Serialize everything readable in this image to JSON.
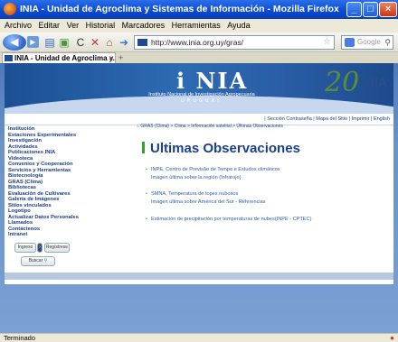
{
  "window": {
    "title": "INIA - Unidad de Agroclima y Sistemas de Información - Mozilla Firefox"
  },
  "menu": [
    "Archivo",
    "Editar",
    "Ver",
    "Historial",
    "Marcadores",
    "Herramientas",
    "Ayuda"
  ],
  "navbar": {
    "url": "http://www.inia.org.uy/gras/",
    "search_placeholder": "Google"
  },
  "tab": {
    "label": "INIA - Unidad de Agroclima y..."
  },
  "banner": {
    "logo": "i NIA",
    "org_name": "Instituto Nacional de Investigación Agropecuaria",
    "country": "URUGUAY",
    "anniversary": "20",
    "anniversary_logo": "i NIA"
  },
  "topnav": "| Sección Contraseña | Mapa del Sitio | Imprimir | English",
  "sidebar": {
    "items": [
      "Institución",
      "Estaciones Experimentales",
      "Investigación",
      "Actividades",
      "Publicaciones INIA",
      "Videoteca",
      "Convenios y Cooperación",
      "Servicios y Herramientas",
      "Biotecnología",
      "GRAS (Clima)",
      "Bibliotecas",
      "Evaluación de Cultivares",
      "Galería de Imágenes",
      "Sitios vinculados",
      "Logotipo",
      "Actualizar Datos Personales",
      "Llamados",
      "Contáctenos",
      "Intranet"
    ],
    "ingreso_label": "Ingreso",
    "registrarse_label": "Regístrese",
    "buscar_label": "Buscar"
  },
  "breadcrumb": {
    "home": "GRAS (Clima)",
    "trail": "> Clima > Información satelital > Últimas Observaciones"
  },
  "main": {
    "title": "Ultimas Observaciones",
    "items": [
      {
        "line1": "INPE, Centro de Previsão de Tempo e Estudos climáticos",
        "line2": "Imagen última sobre la región (Infrarojo)"
      },
      {
        "line1": "SMNA, Temperatura de topes nubosos",
        "line2": "Imagen última sobre América del Sur - Referencias"
      },
      {
        "line1": "Estimación de precipitación por temperaturas de nubes(INPE - CPTEC)",
        "line2": ""
      }
    ]
  },
  "status": {
    "text": "Terminado"
  }
}
